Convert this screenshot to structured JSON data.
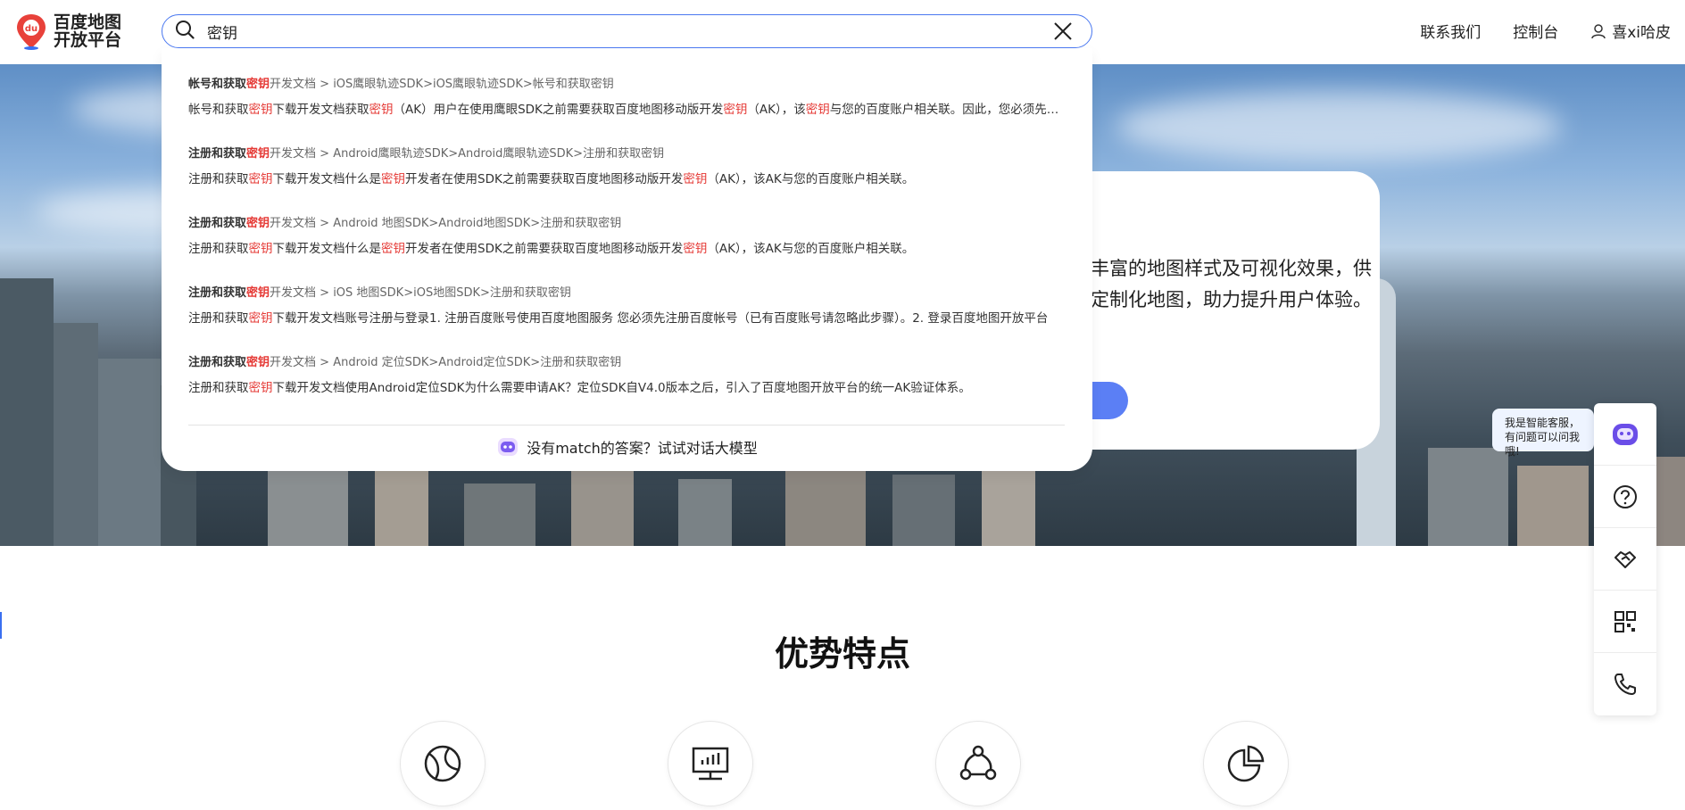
{
  "header": {
    "logo_text": "百度地图开放平台",
    "logo_badge": "du",
    "nav": [
      "联系我们",
      "控制台"
    ],
    "user_name": "喜xi哈皮",
    "user_icon": "user-icon"
  },
  "search": {
    "value": "密钥",
    "icon": "search-icon",
    "clear_icon": "close-icon"
  },
  "results": [
    {
      "title_prefix": "帐号和获取",
      "title_hl": "密钥",
      "path": "开发文档 > iOS鹰眼轨迹SDK>iOS鹰眼轨迹SDK>帐号和获取密钥",
      "body_parts": [
        "帐号和获取",
        "密钥",
        "下载开发文档获取",
        "密钥",
        "（AK）用户在使用鹰眼SDK之前需要获取百度地图移动版开发",
        "密钥",
        "（AK），该",
        "密钥",
        "与您的百度账户相关联。因此，您必须先登录百度账号，才能获得开发密钥"
      ]
    },
    {
      "title_prefix": "注册和获取",
      "title_hl": "密钥",
      "path": "开发文档 > Android鹰眼轨迹SDK>Android鹰眼轨迹SDK>注册和获取密钥",
      "body_parts": [
        "注册和获取",
        "密钥",
        "下载开发文档什么是",
        "密钥",
        "开发者在使用SDK之前需要获取百度地图移动版开发",
        "密钥",
        "（AK），该AK与您的百度账户相关联。"
      ]
    },
    {
      "title_prefix": "注册和获取",
      "title_hl": "密钥",
      "path": "开发文档 > Android 地图SDK>Android地图SDK>注册和获取密钥",
      "body_parts": [
        "注册和获取",
        "密钥",
        "下载开发文档什么是",
        "密钥",
        "开发者在使用SDK之前需要获取百度地图移动版开发",
        "密钥",
        "（AK），该AK与您的百度账户相关联。"
      ]
    },
    {
      "title_prefix": "注册和获取",
      "title_hl": "密钥",
      "path": "开发文档 > iOS 地图SDK>iOS地图SDK>注册和获取密钥",
      "body_parts": [
        "注册和获取",
        "密钥",
        "下载开发文档账号注册与登录1. 注册百度账号使用百度地图服务 您必须先注册百度帐号（已有百度账号请忽略此步骤）。2. 登录百度地图开放平台"
      ]
    },
    {
      "title_prefix": "注册和获取",
      "title_hl": "密钥",
      "path": "开发文档 > Android 定位SDK>Android定位SDK>注册和获取密钥",
      "body_parts": [
        "注册和获取",
        "密钥",
        "下载开发文档使用Android定位SDK为什么需要申请AK？定位SDK自V4.0版本之后，引入了百度地图开放平台的统一AK验证体系。"
      ]
    }
  ],
  "ai_prompt": "没有match的答案？试试对话大模型",
  "hero": {
    "desc": "丰富的地图样式及可视化效果，供定制化地图，助力提升用户体验。"
  },
  "section_title": "优势特点",
  "features": [
    {
      "icon": "globe-icon"
    },
    {
      "icon": "monitor-chart-icon"
    },
    {
      "icon": "network-icon"
    },
    {
      "icon": "pie-chart-icon"
    }
  ],
  "assistant": {
    "bubble": "我是智能客服，有问题可以问我哦!"
  },
  "toolbar": {
    "items": [
      "help-icon",
      "handshake-icon",
      "qrcode-icon",
      "phone-icon"
    ]
  },
  "colors": {
    "accent": "#4a78f0",
    "highlight": "#e53935",
    "button": "#5b7ff5"
  }
}
